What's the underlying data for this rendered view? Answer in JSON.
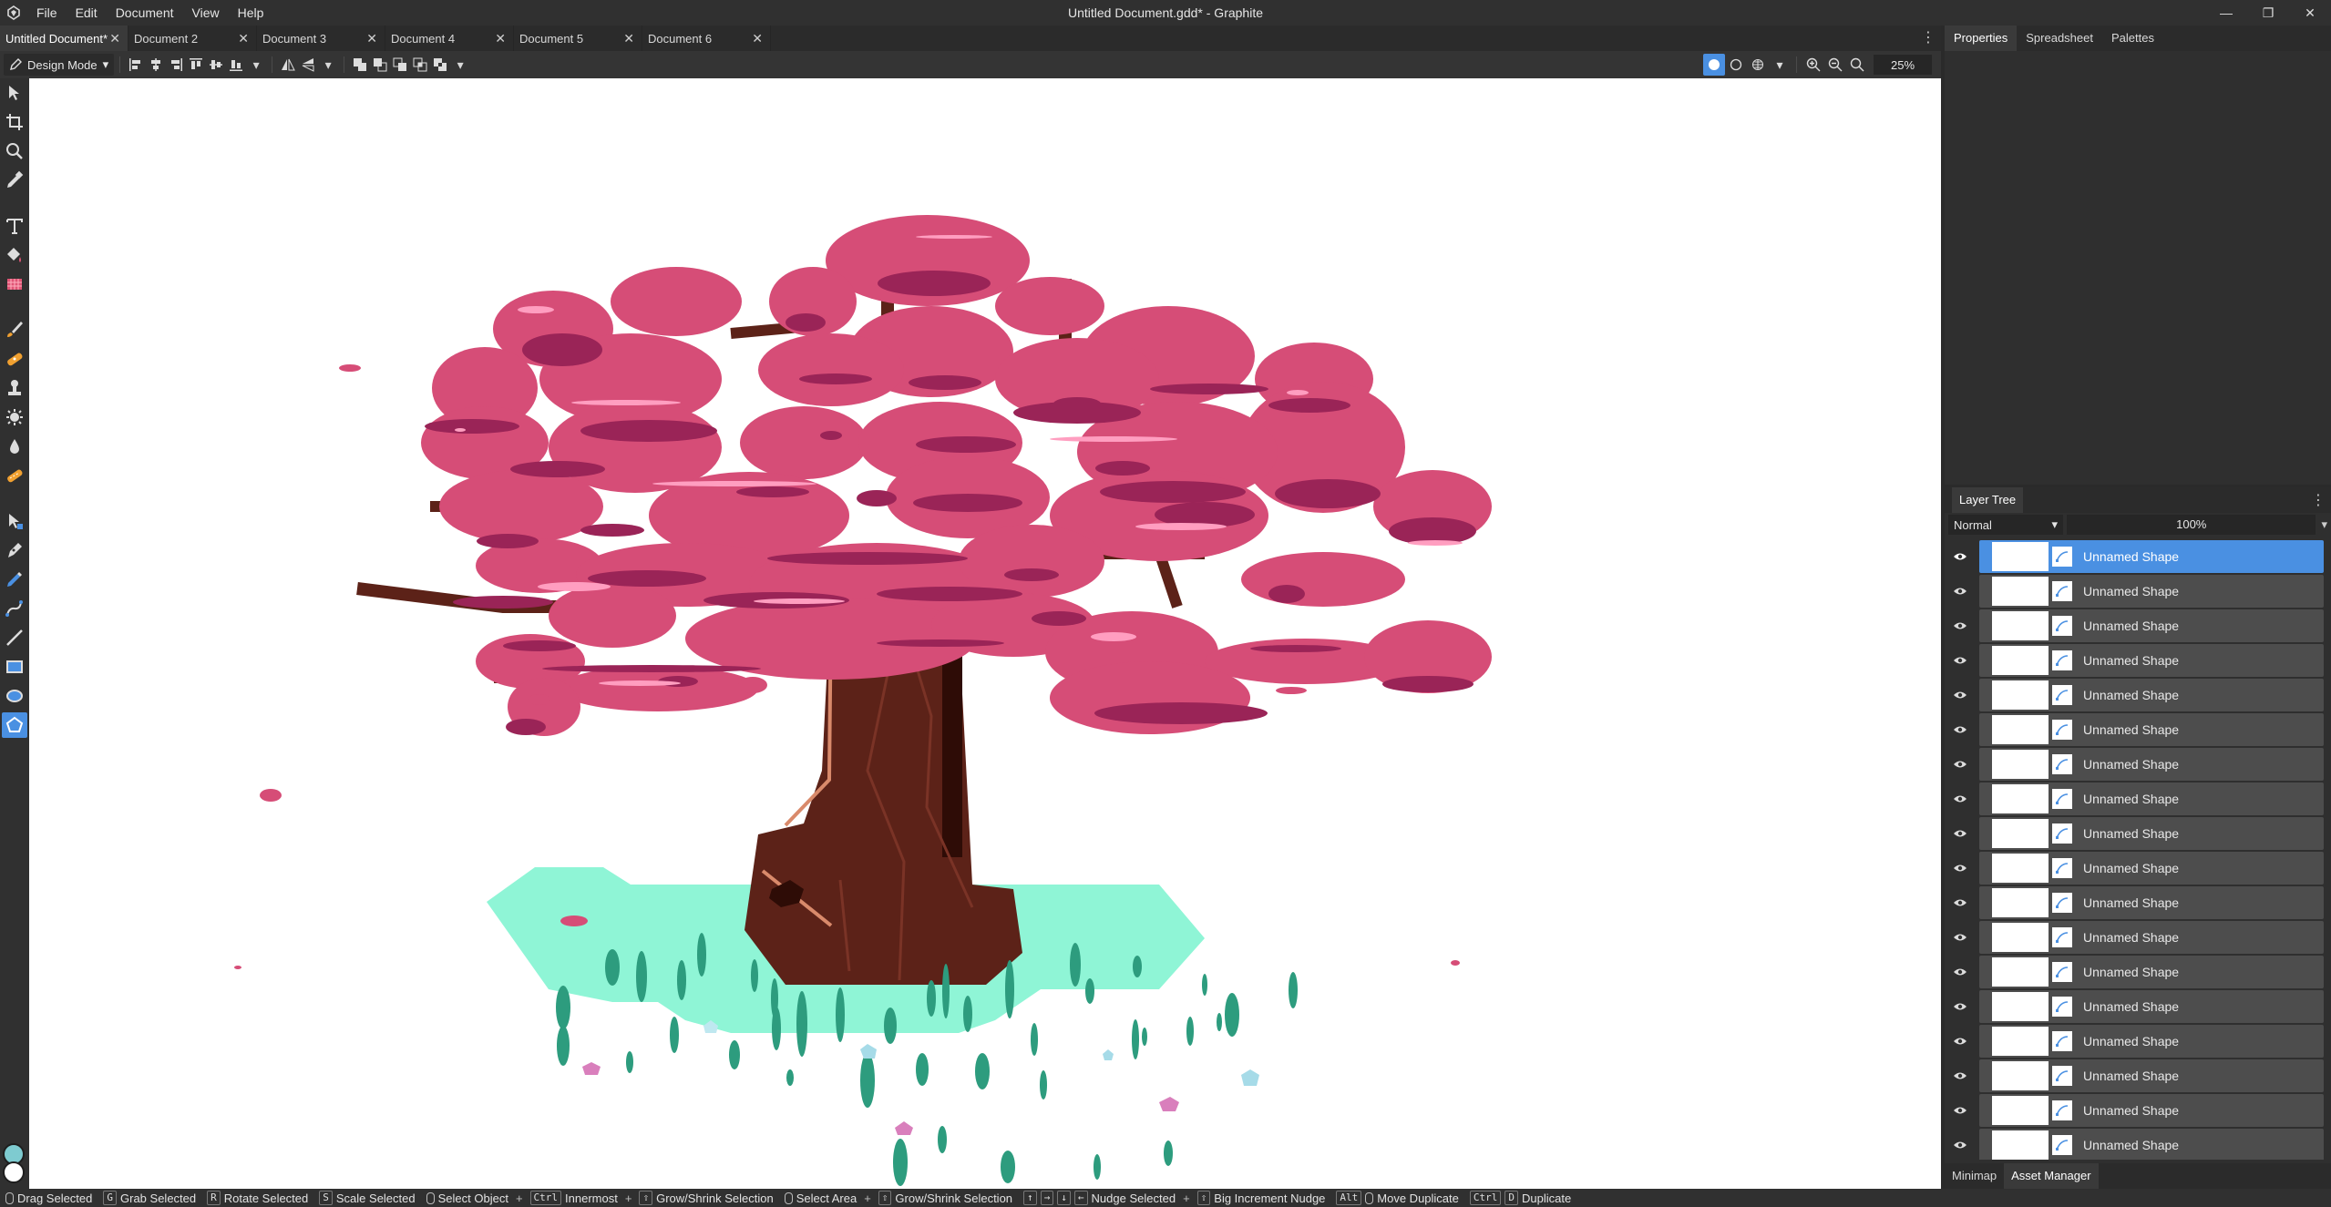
{
  "app": {
    "window_title": "Untitled Document.gdd* - Graphite",
    "menu": [
      "File",
      "Edit",
      "Document",
      "View",
      "Help"
    ]
  },
  "document_tabs": [
    {
      "label": "Untitled Document*",
      "active": true
    },
    {
      "label": "Document 2",
      "active": false
    },
    {
      "label": "Document 3",
      "active": false
    },
    {
      "label": "Document 4",
      "active": false
    },
    {
      "label": "Document 5",
      "active": false
    },
    {
      "label": "Document 6",
      "active": false
    }
  ],
  "right_panel_tabs": [
    "Properties",
    "Spreadsheet",
    "Palettes"
  ],
  "controlbar": {
    "mode": "Design Mode",
    "zoom": "25%"
  },
  "tools": [
    "select-tool-icon",
    "artboard-tool-icon",
    "navigate-tool-icon",
    "eyedropper-tool-icon",
    "text-tool-icon",
    "fill-tool-icon",
    "gradient-tool-icon",
    "brush-tool-icon",
    "heal-tool-icon",
    "clone-tool-icon",
    "patch-tool-icon",
    "detail-tool-icon",
    "relight-tool-icon",
    "path-tool-icon",
    "pen-tool-icon",
    "freehand-tool-icon",
    "spline-tool-icon",
    "line-tool-icon",
    "rectangle-tool-icon",
    "ellipse-tool-icon",
    "polygon-tool-icon"
  ],
  "colors": {
    "accent": "#4a90e2",
    "blossom": "#d64d77",
    "blossom_shadow": "#9a2457",
    "blossom_highlight": "#ff9ec0",
    "bark": "#5c2218",
    "bark_light": "#d98a6b",
    "grass": "#8ff5d6",
    "grass_blade": "#2d9c7e",
    "primary_swatch": "#7ecbd0",
    "secondary_swatch": "#ffffff"
  },
  "layer_panel": {
    "title": "Layer Tree",
    "blend_mode": "Normal",
    "opacity": "100%",
    "layers": [
      {
        "name": "Unnamed Shape",
        "selected": true
      },
      {
        "name": "Unnamed Shape",
        "selected": false
      },
      {
        "name": "Unnamed Shape",
        "selected": false
      },
      {
        "name": "Unnamed Shape",
        "selected": false
      },
      {
        "name": "Unnamed Shape",
        "selected": false
      },
      {
        "name": "Unnamed Shape",
        "selected": false
      },
      {
        "name": "Unnamed Shape",
        "selected": false
      },
      {
        "name": "Unnamed Shape",
        "selected": false
      },
      {
        "name": "Unnamed Shape",
        "selected": false
      },
      {
        "name": "Unnamed Shape",
        "selected": false
      },
      {
        "name": "Unnamed Shape",
        "selected": false
      },
      {
        "name": "Unnamed Shape",
        "selected": false
      },
      {
        "name": "Unnamed Shape",
        "selected": false
      },
      {
        "name": "Unnamed Shape",
        "selected": false
      },
      {
        "name": "Unnamed Shape",
        "selected": false
      },
      {
        "name": "Unnamed Shape",
        "selected": false
      },
      {
        "name": "Unnamed Shape",
        "selected": false
      },
      {
        "name": "Unnamed Shape",
        "selected": false
      }
    ],
    "bottom_tabs": [
      "Minimap",
      "Asset Manager"
    ]
  },
  "statusbar": {
    "drag_selected": "Drag Selected",
    "grab_key": "G",
    "grab_selected": "Grab Selected",
    "rotate_key": "R",
    "rotate_selected": "Rotate Selected",
    "scale_key": "S",
    "scale_selected": "Scale Selected",
    "select_object": "Select Object",
    "ctrl_key": "Ctrl",
    "innermost": "Innermost",
    "grow_shrink_1": "Grow/Shrink Selection",
    "select_area": "Select Area",
    "grow_shrink_2": "Grow/Shrink Selection",
    "nudge_selected": "Nudge Selected",
    "big_nudge": "Big Increment Nudge",
    "alt_key": "Alt",
    "move_duplicate": "Move Duplicate",
    "ctrl_key_2": "Ctrl",
    "d_key": "D",
    "duplicate": "Duplicate"
  }
}
